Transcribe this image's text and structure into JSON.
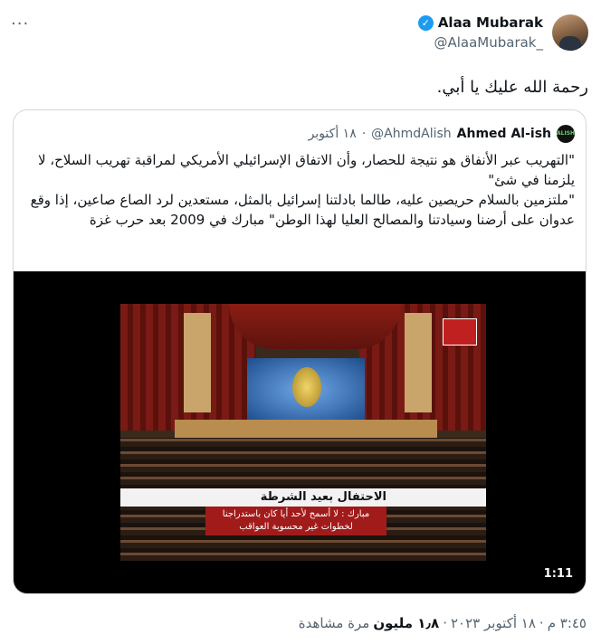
{
  "tweet": {
    "more_icon": "more-horizontal-icon",
    "author": {
      "display_name": "Alaa Mubarak",
      "handle": "@AlaaMubarak_",
      "verified_icon": "verified-badge-icon"
    },
    "text": "رحمة الله عليك يا أبي."
  },
  "quoted": {
    "author": {
      "display_name": "Ahmed Al-ish",
      "handle": "@AhmdAlish",
      "date": "١٨ أكتوبر",
      "separator": "·"
    },
    "text": "\"التهريب عبر الأنفاق هو نتيجة للحصار، وأن الاتفاق الإسرائيلي الأمريكي لمراقبة تهريب السلاح، لا يلزمنا في شئ\"\n\"ملتزمين بالسلام حريصين عليه، طالما بادلتنا إسرائيل بالمثل، مستعدين لرد الصاع صاعين، إذا وقع عدوان على أرضنا وسيادتنا والمصالح العليا لهذا الوطن\" مبارك في 2009 بعد حرب غزة",
    "video": {
      "duration": "1:11",
      "caption_title": "الاحتفال بعيد الشرطة",
      "caption_sub": "مبارك : لا أسمح لأحد أيا كان باستدراجنا لخطوات غير محسوبة العواقب"
    }
  },
  "meta": {
    "time": "٣:٤٥ م",
    "date": "١٨ أكتوبر ٢٠٢٣",
    "dot1": "·",
    "dot2": "·",
    "views_count": "١٫٨ مليون",
    "views_label": "مرة مشاهدة"
  },
  "colors": {
    "verified": "#1d9bf0",
    "secondary_text": "#536471",
    "border": "#cfd9de"
  }
}
